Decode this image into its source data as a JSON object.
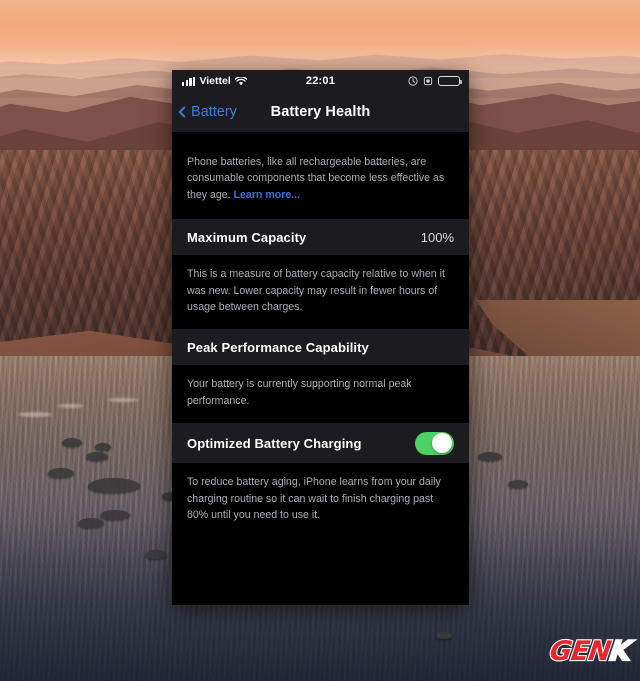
{
  "wallpaper": {
    "name": "big-sur-sunset-coast"
  },
  "phone": {
    "status_bar": {
      "carrier": "Viettel",
      "time": "22:01",
      "signal_icon": "signal-bars-icon",
      "wifi_icon": "wifi-icon",
      "alarm_icon": "alarm-clock-icon",
      "rotation_lock_icon": "rotation-lock-icon",
      "battery_icon": "battery-icon"
    },
    "nav": {
      "back_label": "Battery",
      "back_icon": "chevron-left-icon",
      "title": "Battery Health"
    },
    "intro": {
      "text": "Phone batteries, like all rechargeable batteries, are consumable components that become less effective as they age. ",
      "link": "Learn more...",
      "link_color": "#3f6fd8"
    },
    "sections": [
      {
        "title": "Maximum Capacity",
        "value": "100%",
        "description": "This is a measure of battery capacity relative to when it was new. Lower capacity may result in fewer hours of usage between charges."
      },
      {
        "title": "Peak Performance Capability",
        "value": "",
        "description": "Your battery is currently supporting normal peak performance."
      }
    ],
    "toggle_section": {
      "title": "Optimized Battery Charging",
      "toggle_state": "on",
      "toggle_color": "#4cd364",
      "description": "To reduce battery aging, iPhone learns from your daily charging routine so it can wait to finish charging past 80% until you need to use it."
    }
  },
  "watermark": {
    "part1": "GEN",
    "part2": "K",
    "color1": "#e8262d",
    "color2": "#ffffff"
  }
}
